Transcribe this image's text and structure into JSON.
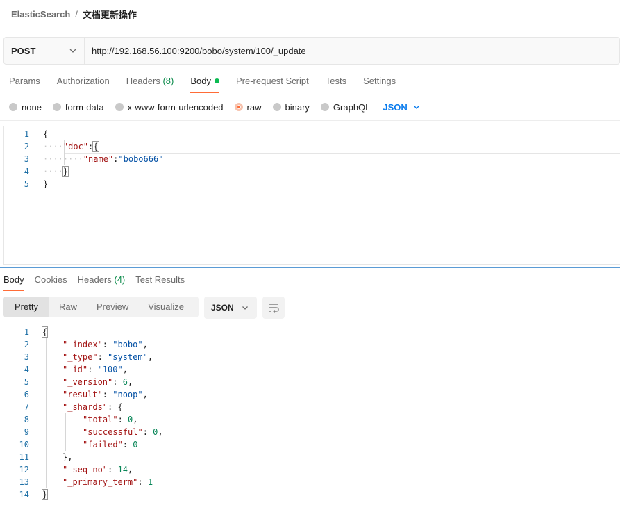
{
  "breadcrumb": {
    "root": "ElasticSearch",
    "separator": "/",
    "current": "文档更新操作"
  },
  "request": {
    "method": "POST",
    "url": "http://192.168.56.100:9200/bobo/system/100/_update"
  },
  "request_tabs": [
    {
      "label": "Params",
      "count": ""
    },
    {
      "label": "Authorization",
      "count": ""
    },
    {
      "label": "Headers",
      "count": "(8)"
    },
    {
      "label": "Body",
      "count": ""
    },
    {
      "label": "Pre-request Script",
      "count": ""
    },
    {
      "label": "Tests",
      "count": ""
    },
    {
      "label": "Settings",
      "count": ""
    }
  ],
  "body_types": [
    "none",
    "form-data",
    "x-www-form-urlencoded",
    "raw",
    "binary",
    "GraphQL"
  ],
  "body_type_selected": "raw",
  "body_language": "JSON",
  "request_body": {
    "line_numbers": [
      "1",
      "2",
      "3",
      "4",
      "5"
    ],
    "brace_open": "{",
    "brace_close": "}",
    "doc_key": "\"doc\"",
    "name_key": "\"name\"",
    "name_value": "\"bobo666\"",
    "colon": ":"
  },
  "response_tabs": [
    {
      "label": "Body",
      "count": ""
    },
    {
      "label": "Cookies",
      "count": ""
    },
    {
      "label": "Headers",
      "count": "(4)"
    },
    {
      "label": "Test Results",
      "count": ""
    }
  ],
  "view_modes": [
    "Pretty",
    "Raw",
    "Preview",
    "Visualize"
  ],
  "view_selected": "Pretty",
  "response_format": "JSON",
  "response_body": {
    "line_numbers": [
      "1",
      "2",
      "3",
      "4",
      "5",
      "6",
      "7",
      "8",
      "9",
      "10",
      "11",
      "12",
      "13",
      "14"
    ],
    "index_key": "\"_index\"",
    "index_val": "\"bobo\"",
    "type_key": "\"_type\"",
    "type_val": "\"system\"",
    "id_key": "\"_id\"",
    "id_val": "\"100\"",
    "version_key": "\"_version\"",
    "version_val": "6",
    "result_key": "\"result\"",
    "result_val": "\"noop\"",
    "shards_key": "\"_shards\"",
    "total_key": "\"total\"",
    "total_val": "0",
    "successful_key": "\"successful\"",
    "successful_val": "0",
    "failed_key": "\"failed\"",
    "failed_val": "0",
    "seq_key": "\"_seq_no\"",
    "seq_val": "14",
    "term_key": "\"_primary_term\"",
    "term_val": "1"
  },
  "colors": {
    "accent": "#ff6c37",
    "link_blue": "#097bed",
    "count_green": "#0a8a4a",
    "status_dot": "#0cbb52"
  },
  "icons": {
    "method_dropdown": "chevron-down-icon",
    "language_dropdown": "chevron-down-icon",
    "wrap": "wrap-lines-icon"
  }
}
